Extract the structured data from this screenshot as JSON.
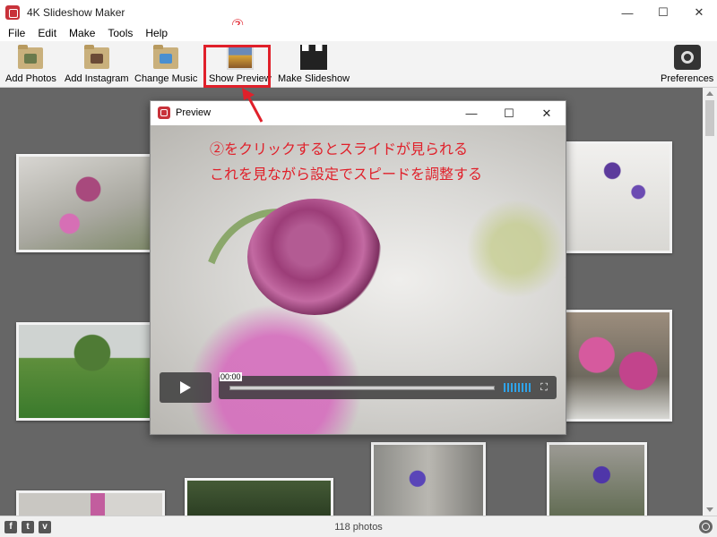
{
  "window": {
    "title": "4K Slideshow Maker",
    "controls": {
      "minimize": "—",
      "maximize": "☐",
      "close": "✕"
    }
  },
  "menu": [
    "File",
    "Edit",
    "Make",
    "Tools",
    "Help"
  ],
  "toolbar": {
    "add_photos": "Add Photos",
    "add_instagram": "Add Instagram",
    "change_music": "Change Music",
    "show_preview": "Show Preview",
    "make_slideshow": "Make Slideshow",
    "preferences": "Preferences"
  },
  "annotation": {
    "marker": "②",
    "line1": "②をクリックするとスライドが見られる",
    "line2": "これを見ながら設定でスピードを調整する",
    "color": "#e0202a"
  },
  "preview": {
    "title": "Preview",
    "time": "00:00",
    "controls": {
      "minimize": "—",
      "maximize": "☐",
      "close": "✕"
    }
  },
  "status": {
    "photo_count": "118 photos",
    "social": [
      "f",
      "t",
      "v"
    ]
  }
}
